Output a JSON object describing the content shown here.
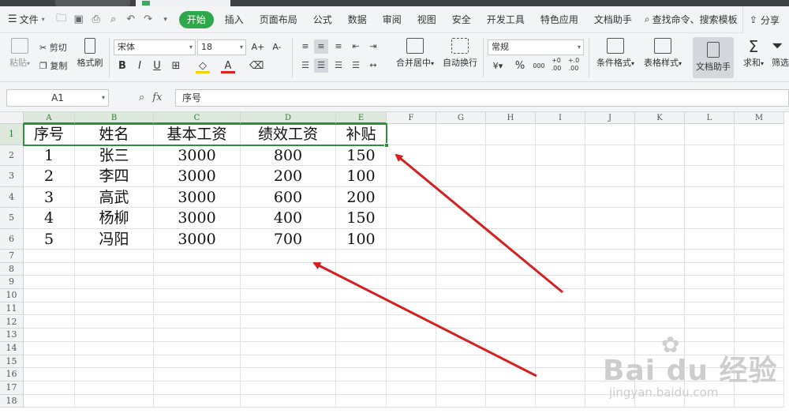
{
  "menubar": {
    "file_label": "文件",
    "tabs": [
      "开始",
      "插入",
      "页面布局",
      "公式",
      "数据",
      "审阅",
      "视图",
      "安全",
      "开发工具",
      "特色应用",
      "文档助手"
    ],
    "active_tab": "开始",
    "search_label": "查找命令、搜索模板",
    "share_label": "分享"
  },
  "ribbon": {
    "paste_label": "粘贴",
    "cut_label": "剪切",
    "copy_label": "复制",
    "format_painter_label": "格式刷",
    "font_name": "宋体",
    "font_size": "18",
    "bold": "B",
    "italic": "I",
    "underline": "U",
    "font_color_glyph": "A",
    "merge_center_label": "合并居中",
    "wrap_text_label": "自动换行",
    "number_format": "常规",
    "percent": "%",
    "thousands": "000",
    "inc_decimal": "+0 .00",
    "dec_decimal": "+.0 .00",
    "conditional_format_label": "条件格式",
    "table_style_label": "表格样式",
    "doc_assistant_label": "文档助手",
    "sum_label": "求和",
    "filter_label": "筛选",
    "increase_font": "A+",
    "decrease_font": "A-"
  },
  "formula_bar": {
    "name_box": "A1",
    "fx": "fx",
    "content": "序号"
  },
  "sheet": {
    "columns": [
      "A",
      "B",
      "C",
      "D",
      "E",
      "F",
      "G",
      "H",
      "I",
      "J",
      "K",
      "L",
      "M"
    ],
    "rows": [
      "1",
      "2",
      "3",
      "4",
      "5",
      "6",
      "7",
      "8",
      "9",
      "10",
      "11",
      "12",
      "13",
      "14",
      "15",
      "16",
      "17",
      "18"
    ],
    "header": [
      "序号",
      "姓名",
      "基本工资",
      "绩效工资",
      "补贴"
    ],
    "data": [
      [
        "1",
        "张三",
        "3000",
        "800",
        "150"
      ],
      [
        "2",
        "李四",
        "3000",
        "200",
        "100"
      ],
      [
        "3",
        "高武",
        "3000",
        "600",
        "200"
      ],
      [
        "4",
        "杨柳",
        "3000",
        "400",
        "150"
      ],
      [
        "5",
        "冯阳",
        "3000",
        "700",
        "100"
      ]
    ]
  },
  "watermark": {
    "brand": "Bai du 经验",
    "site": "jingyan.baidu.com"
  },
  "colors": {
    "accent": "#2ea84b",
    "selection": "#2f8f3f",
    "arrow": "#d42020"
  }
}
